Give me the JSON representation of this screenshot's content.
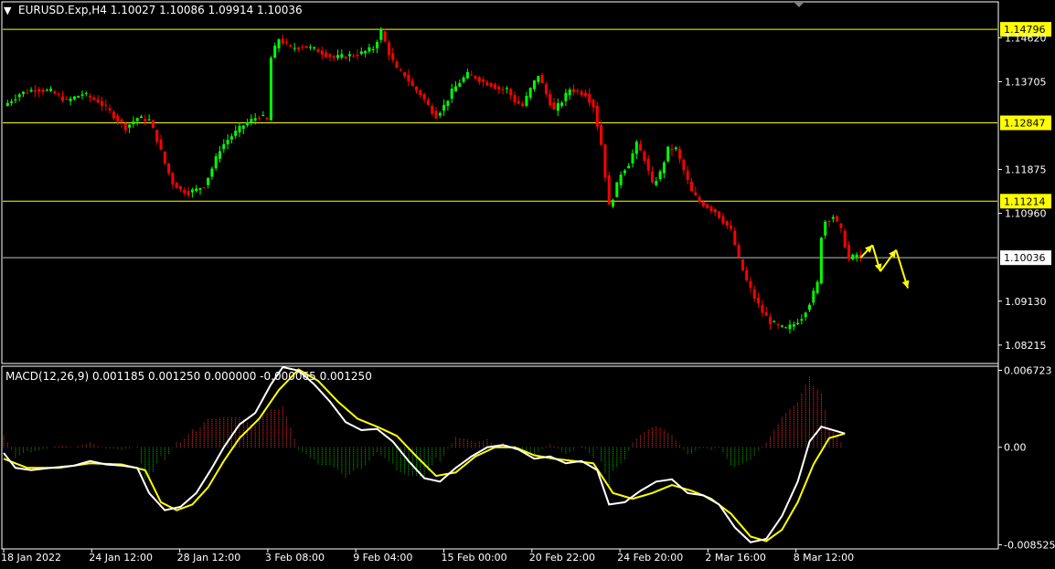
{
  "header": {
    "menu_glyph": "▼",
    "symbol_label": "EURUSD.Exp,H4  1.10027 1.10086 1.09914 1.10036"
  },
  "chart_data": [
    {
      "type": "candlestick",
      "symbol": "EURUSD.Exp",
      "timeframe": "H4",
      "ohlc_last": {
        "open": 1.10027,
        "high": 1.10086,
        "low": 1.09914,
        "close": 1.10036
      },
      "ylim": [
        1.0785,
        1.1535
      ],
      "price_tick_labels": [
        "1.14620",
        "1.13705",
        "1.11875",
        "1.10960",
        "1.09130",
        "1.08215"
      ],
      "price_ticks": [
        1.1462,
        1.13705,
        1.11875,
        1.1096,
        1.0913,
        1.08215
      ],
      "horizontal_levels": [
        {
          "value": 1.14796,
          "label": "1.14796",
          "color": "#ffff00"
        },
        {
          "value": 1.12847,
          "label": "1.12847",
          "color": "#ffff00"
        },
        {
          "value": 1.11214,
          "label": "1.11214",
          "color": "#ffff00"
        }
      ],
      "current_price": {
        "value": 1.10036,
        "label": "1.10036",
        "color": "#c0c0c0"
      },
      "bull_color": "#00ff00",
      "bear_color": "#ff0000",
      "close_path": [
        [
          0,
          1.132
        ],
        [
          4,
          1.1345
        ],
        [
          8,
          1.1355
        ],
        [
          12,
          1.135
        ],
        [
          16,
          1.133
        ],
        [
          20,
          1.1345
        ],
        [
          24,
          1.133
        ],
        [
          28,
          1.13
        ],
        [
          31,
          1.1275
        ],
        [
          34,
          1.1295
        ],
        [
          37,
          1.129
        ],
        [
          39,
          1.125
        ],
        [
          41,
          1.12
        ],
        [
          43,
          1.116
        ],
        [
          45,
          1.1145
        ],
        [
          47,
          1.114
        ],
        [
          49,
          1.1145
        ],
        [
          51,
          1.1155
        ],
        [
          53,
          1.119
        ],
        [
          55,
          1.123
        ],
        [
          57,
          1.125
        ],
        [
          59,
          1.1265
        ],
        [
          61,
          1.128
        ],
        [
          63,
          1.129
        ],
        [
          65,
          1.13
        ],
        [
          67,
          1.129
        ],
        [
          68,
          1.142
        ],
        [
          70,
          1.146
        ],
        [
          73,
          1.144
        ],
        [
          76,
          1.1445
        ],
        [
          80,
          1.1435
        ],
        [
          84,
          1.142
        ],
        [
          88,
          1.1425
        ],
        [
          91,
          1.143
        ],
        [
          94,
          1.144
        ],
        [
          96,
          1.1475
        ],
        [
          98,
          1.143
        ],
        [
          100,
          1.1395
        ],
        [
          102,
          1.1385
        ],
        [
          104,
          1.136
        ],
        [
          106,
          1.1345
        ],
        [
          108,
          1.132
        ],
        [
          110,
          1.13
        ],
        [
          112,
          1.132
        ],
        [
          114,
          1.135
        ],
        [
          116,
          1.137
        ],
        [
          118,
          1.1385
        ],
        [
          120,
          1.138
        ],
        [
          122,
          1.137
        ],
        [
          124,
          1.1365
        ],
        [
          126,
          1.1355
        ],
        [
          128,
          1.1355
        ],
        [
          130,
          1.133
        ],
        [
          132,
          1.132
        ],
        [
          134,
          1.1355
        ],
        [
          136,
          1.1385
        ],
        [
          138,
          1.1345
        ],
        [
          140,
          1.131
        ],
        [
          142,
          1.133
        ],
        [
          144,
          1.1355
        ],
        [
          146,
          1.135
        ],
        [
          148,
          1.1345
        ],
        [
          150,
          1.132
        ],
        [
          152,
          1.124
        ],
        [
          154,
          1.111
        ],
        [
          155,
          1.113
        ],
        [
          157,
          1.118
        ],
        [
          159,
          1.12
        ],
        [
          161,
          1.124
        ],
        [
          163,
          1.121
        ],
        [
          165,
          1.1155
        ],
        [
          167,
          1.118
        ],
        [
          169,
          1.123
        ],
        [
          171,
          1.123
        ],
        [
          173,
          1.1185
        ],
        [
          175,
          1.114
        ],
        [
          177,
          1.112
        ],
        [
          179,
          1.111
        ],
        [
          181,
          1.11
        ],
        [
          183,
          1.108
        ],
        [
          185,
          1.106
        ],
        [
          187,
          1.1
        ],
        [
          189,
          1.0955
        ],
        [
          191,
          1.092
        ],
        [
          193,
          1.089
        ],
        [
          195,
          1.087
        ],
        [
          197,
          1.086
        ],
        [
          199,
          1.0855
        ],
        [
          201,
          1.0865
        ],
        [
          203,
          1.088
        ],
        [
          205,
          1.091
        ],
        [
          207,
          1.095
        ],
        [
          208,
          1.105
        ],
        [
          209,
          1.108
        ],
        [
          211,
          1.109
        ],
        [
          213,
          1.106
        ],
        [
          215,
          1.1
        ],
        [
          217,
          1.101
        ],
        [
          218,
          1.10036
        ]
      ],
      "projection_arrows": [
        [
          [
            1.10036,
            0
          ],
          [
            1.103,
            3
          ]
        ],
        [
          [
            1.103,
            3
          ],
          [
            1.0975,
            5
          ]
        ],
        [
          [
            1.0975,
            5
          ],
          [
            1.102,
            9
          ]
        ],
        [
          [
            1.102,
            9
          ],
          [
            1.094,
            12
          ]
        ]
      ],
      "time_labels": [
        "18 Jan 2022",
        "24 Jan 12:00",
        "28 Jan 12:00",
        "3 Feb 08:00",
        "9 Feb 04:00",
        "15 Feb 00:00",
        "20 Feb 22:00",
        "24 Feb 20:00",
        "2 Mar 16:00",
        "8 Mar 12:00"
      ]
    },
    {
      "type": "macd",
      "title": "MACD(12,26,9) 0.001185 0.001250 0.000000 -0.000065 0.001250",
      "ylim": [
        -0.0088,
        0.007
      ],
      "tick_labels": [
        "0.006723",
        "0.00",
        "-0.008525"
      ],
      "ticks": [
        0.006723,
        0.0,
        -0.008525
      ],
      "main_color": "#ffffff",
      "signal_color": "#ffff00",
      "hist_pos_color": "#ff3030",
      "hist_neg_color": "#00c000",
      "main_path": [
        [
          0,
          -0.0005
        ],
        [
          3,
          -0.0018
        ],
        [
          7,
          -0.002
        ],
        [
          12,
          -0.0018
        ],
        [
          18,
          -0.0016
        ],
        [
          22,
          -0.0012
        ],
        [
          26,
          -0.0015
        ],
        [
          30,
          -0.0016
        ],
        [
          34,
          -0.0018
        ],
        [
          37,
          -0.004
        ],
        [
          41,
          -0.0055
        ],
        [
          45,
          -0.0052
        ],
        [
          49,
          -0.004
        ],
        [
          53,
          -0.0018
        ],
        [
          56,
          0.0
        ],
        [
          60,
          0.002
        ],
        [
          64,
          0.003
        ],
        [
          68,
          0.0055
        ],
        [
          71,
          0.007
        ],
        [
          75,
          0.0067
        ],
        [
          79,
          0.0055
        ],
        [
          83,
          0.004
        ],
        [
          87,
          0.0022
        ],
        [
          91,
          0.0015
        ],
        [
          95,
          0.0016
        ],
        [
          99,
          0.0005
        ],
        [
          103,
          -0.0012
        ],
        [
          107,
          -0.0027
        ],
        [
          111,
          -0.003
        ],
        [
          115,
          -0.0018
        ],
        [
          119,
          -0.0008
        ],
        [
          123,
          0.0
        ],
        [
          127,
          0.0002
        ],
        [
          131,
          -0.0002
        ],
        [
          135,
          -0.001
        ],
        [
          139,
          -0.0008
        ],
        [
          143,
          -0.0014
        ],
        [
          147,
          -0.0012
        ],
        [
          151,
          -0.002
        ],
        [
          154,
          -0.005
        ],
        [
          158,
          -0.0048
        ],
        [
          162,
          -0.0038
        ],
        [
          166,
          -0.003
        ],
        [
          170,
          -0.0028
        ],
        [
          174,
          -0.004
        ],
        [
          178,
          -0.0042
        ],
        [
          182,
          -0.005
        ],
        [
          186,
          -0.007
        ],
        [
          190,
          -0.0083
        ],
        [
          194,
          -0.008
        ],
        [
          198,
          -0.006
        ],
        [
          202,
          -0.003
        ],
        [
          205,
          0.0005
        ],
        [
          208,
          0.0018
        ],
        [
          212,
          0.0014
        ],
        [
          214,
          0.0012
        ]
      ],
      "signal_path": [
        [
          0,
          -0.001
        ],
        [
          6,
          -0.0018
        ],
        [
          14,
          -0.0018
        ],
        [
          22,
          -0.0014
        ],
        [
          30,
          -0.0015
        ],
        [
          36,
          -0.002
        ],
        [
          40,
          -0.0048
        ],
        [
          44,
          -0.0055
        ],
        [
          48,
          -0.005
        ],
        [
          52,
          -0.0035
        ],
        [
          56,
          -0.0012
        ],
        [
          60,
          0.0008
        ],
        [
          65,
          0.0025
        ],
        [
          70,
          0.005
        ],
        [
          75,
          0.0068
        ],
        [
          80,
          0.0058
        ],
        [
          85,
          0.004
        ],
        [
          90,
          0.0025
        ],
        [
          95,
          0.0018
        ],
        [
          100,
          0.001
        ],
        [
          105,
          -0.0008
        ],
        [
          110,
          -0.0025
        ],
        [
          115,
          -0.0022
        ],
        [
          120,
          -0.0008
        ],
        [
          125,
          0.0
        ],
        [
          130,
          0.0
        ],
        [
          135,
          -0.0007
        ],
        [
          140,
          -0.001
        ],
        [
          145,
          -0.0012
        ],
        [
          150,
          -0.0014
        ],
        [
          155,
          -0.004
        ],
        [
          160,
          -0.0045
        ],
        [
          165,
          -0.004
        ],
        [
          170,
          -0.0033
        ],
        [
          175,
          -0.0038
        ],
        [
          180,
          -0.0045
        ],
        [
          185,
          -0.0058
        ],
        [
          190,
          -0.0078
        ],
        [
          194,
          -0.0082
        ],
        [
          198,
          -0.0072
        ],
        [
          202,
          -0.0048
        ],
        [
          206,
          -0.0015
        ],
        [
          210,
          0.0008
        ],
        [
          214,
          0.0012
        ]
      ]
    }
  ]
}
